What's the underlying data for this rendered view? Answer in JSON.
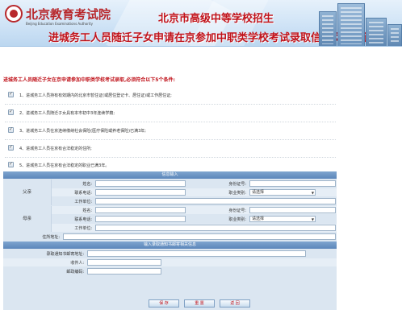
{
  "banner": {
    "logo_cn": "北京教育考试院",
    "logo_en": "Beijing Education Examinations Authority",
    "title": "北京市高级中等学校招生",
    "subtitle": "进城务工人员随迁子女申请在京参加中职类学校考试录取信息网上申请"
  },
  "notice": {
    "heading": "进城务工人员随迁子女在京申请参加中职类学校考试录取,必须符合以下5个条件:",
    "conditions": [
      "1、进城务工人员持有有效期内的北京市暂住证(或居住登记卡、居住证)或工作居住证;",
      "2、进城务工人员随迁子女具有本市初中3年连续学籍;",
      "3、进城务工人员在京连续缴纳社会保险(医疗保险或养老保险)已满3年;",
      "4、进城务工人员在京有合法稳定的住所;",
      "5、进城务工人员在京有合法稳定的职业已满3年。"
    ]
  },
  "form": {
    "section_info": "信息输入",
    "father": {
      "group_label": "父亲",
      "name_label": "姓名:",
      "id_label": "身份证号:",
      "phone_label": "联系电话:",
      "job_label": "职业类别:",
      "job_value": "请选择",
      "work_label": "工作单位:"
    },
    "mother": {
      "group_label": "母亲",
      "name_label": "姓名:",
      "id_label": "身份证号:",
      "phone_label": "联系电话:",
      "job_label": "职业类别:",
      "job_value": "请选择",
      "work_label": "工作单位:"
    },
    "address_label": "住所地址:",
    "section_mail": "输入录取通知书邮寄相关信息",
    "mail_address_label": "录取通知书邮寄地址:",
    "recipient_label": "收件人:",
    "postcode_label": "邮政编码:"
  },
  "buttons": {
    "save": "保  存",
    "reset": "重  置",
    "back": "返  回"
  },
  "colors": {
    "accent_red": "#c0131b",
    "section_blue": "#5b86ba",
    "form_bg": "#dbe6f1"
  }
}
